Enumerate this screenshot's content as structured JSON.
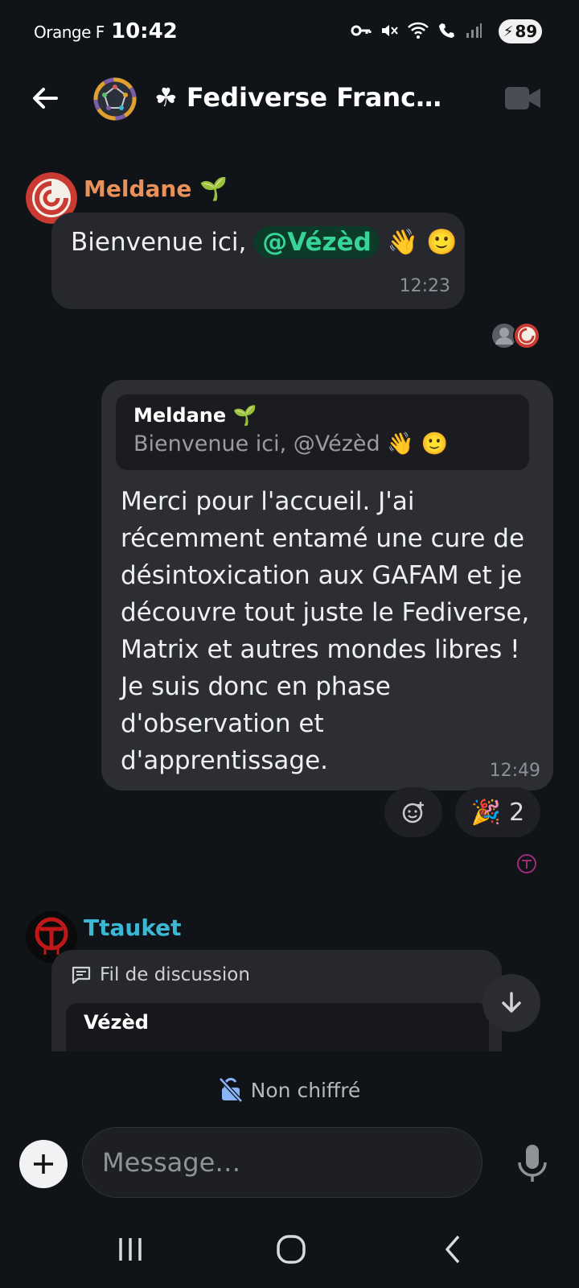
{
  "status_bar": {
    "carrier": "Orange F",
    "time": "10:42",
    "battery": "89"
  },
  "header": {
    "room_title": "☘ Fediverse Francoph…"
  },
  "messages": [
    {
      "sender": "Meldane 🌱",
      "text_before": "Bienvenue ici, ",
      "mention": "@Vézèd",
      "text_after": " 👋 🙂",
      "time": "12:23"
    },
    {
      "quote_sender": "Meldane 🌱",
      "quote_text": "Bienvenue ici, @Vézèd 👋 🙂",
      "text": "Merci pour l'accueil. J'ai récemment entamé une cure de désintoxication aux GAFAM et je découvre tout juste le Fediverse, Matrix et autres mondes libres ! Je suis donc en phase d'observation et d'apprentissage.",
      "time": "12:49",
      "reaction_emoji": "🎉",
      "reaction_count": "2"
    },
    {
      "sender": "Ttauket",
      "thread_label": "Fil de discussion",
      "thread_sender": "Vézèd"
    }
  ],
  "footer": {
    "encryption_status": "Non chiffré",
    "composer_placeholder": "Message…"
  },
  "colors": {
    "background": "#101318",
    "bubble": "#26282d",
    "meldane_name": "#e8915a",
    "ttauket_name": "#3bb8d4",
    "mention": "#37d399"
  }
}
